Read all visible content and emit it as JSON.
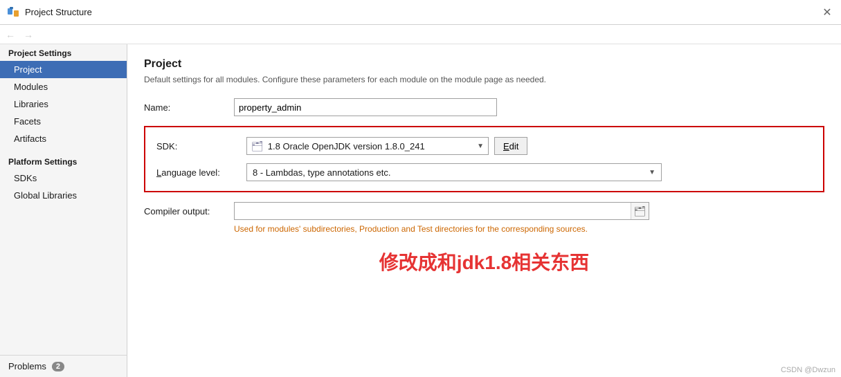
{
  "titleBar": {
    "icon": "project-icon",
    "title": "Project Structure",
    "closeLabel": "✕"
  },
  "nav": {
    "backArrow": "←",
    "forwardArrow": "→"
  },
  "sidebar": {
    "projectSettingsTitle": "Project Settings",
    "items": [
      {
        "id": "project",
        "label": "Project",
        "active": true
      },
      {
        "id": "modules",
        "label": "Modules",
        "active": false
      },
      {
        "id": "libraries",
        "label": "Libraries",
        "active": false
      },
      {
        "id": "facets",
        "label": "Facets",
        "active": false
      },
      {
        "id": "artifacts",
        "label": "Artifacts",
        "active": false
      }
    ],
    "platformSettingsTitle": "Platform Settings",
    "platformItems": [
      {
        "id": "sdks",
        "label": "SDKs",
        "active": false
      },
      {
        "id": "global-libraries",
        "label": "Global Libraries",
        "active": false
      }
    ],
    "problemsLabel": "Problems",
    "problemsCount": "2"
  },
  "content": {
    "title": "Project",
    "subtitle": "Default settings for all modules. Configure these parameters for each module on the module page as needed.",
    "nameLabel": "Name:",
    "nameValue": "property_admin",
    "sdkLabel": "SDK:",
    "sdkValue": "1.8 Oracle OpenJDK version 1.8.0_241",
    "sdkEditLabel": "Edit",
    "languageLevelLabel": "Language level:",
    "languageLevelValue": "8 - Lambdas, type annotations etc.",
    "compilerOutputLabel": "Compiler output:",
    "compilerOutputValue": "",
    "compilerOutputHint": "Used for modules' subdirectories, Production and Test directories for the corresponding sources.",
    "annotationText": "修改成和jdk1.8相关东西"
  },
  "watermark": "CSDN @Dwzun"
}
